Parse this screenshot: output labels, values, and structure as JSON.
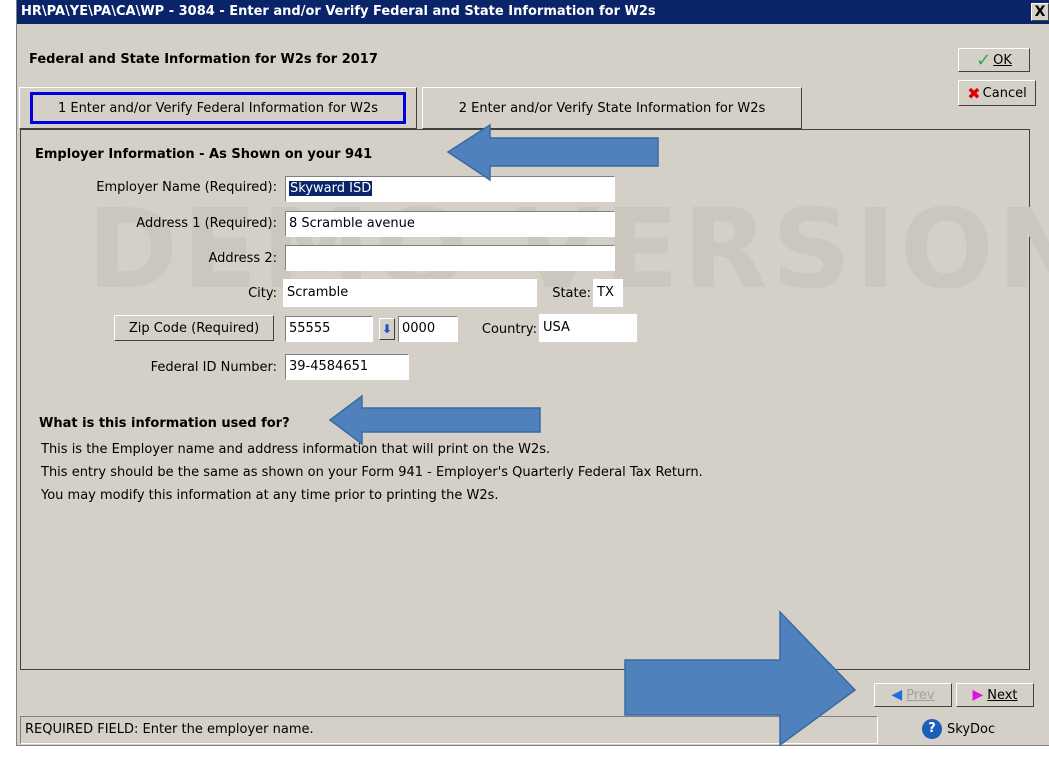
{
  "window": {
    "title": "HR\\PA\\YE\\PA\\CA\\WP - 3084 - Enter and/or Verify Federal and State Information for W2s",
    "close_label": "X"
  },
  "heading": "Federal and State Information for W2s for 2017",
  "toolbar": {
    "ok_label": "OK",
    "cancel_label": "Cancel"
  },
  "tabs": [
    {
      "label": "1 Enter and/or Verify Federal Information for W2s",
      "active": true
    },
    {
      "label": "2 Enter and/or Verify State Information for W2s",
      "active": false
    }
  ],
  "employer": {
    "section_title": "Employer Information - As Shown on your 941",
    "name_label": "Employer Name (Required):",
    "name_value": "Skyward ISD",
    "address1_label": "Address 1 (Required):",
    "address1_value": "8 Scramble avenue",
    "address2_label": "Address 2:",
    "address2_value": "",
    "city_label": "City:",
    "city_value": "Scramble",
    "state_label": "State:",
    "state_value": "TX",
    "zip_button_label": "Zip Code (Required)",
    "zip_value": "55555",
    "zip_ext_value": "0000",
    "country_label": "Country:",
    "country_value": "USA",
    "fedid_label": "Federal ID Number:",
    "fedid_value": "39-4584651"
  },
  "info": {
    "title": "What is this information used for?",
    "lines": [
      "This is the Employer name and address information that will print on the W2s.",
      "This entry should be the same as shown on your Form 941 - Employer's Quarterly Federal Tax Return.",
      "You may modify this information at any time prior to printing the W2s."
    ]
  },
  "watermark": "DEMO VERSION",
  "nav": {
    "prev_label": "Prev",
    "next_label": "Next"
  },
  "status_text": "REQUIRED FIELD: Enter the employer name.",
  "skydoc_label": "SkyDoc",
  "icons": {
    "ok": "checkmark-icon",
    "cancel": "x-icon",
    "prev": "triangle-left-icon",
    "next": "triangle-right-icon",
    "help": "question-circle-icon",
    "zip_lookup": "down-arrow-icon"
  },
  "colors": {
    "titlebar": "#0a246a",
    "annotation_arrow": "#4f81bd",
    "tab_focus": "#0000e0"
  }
}
